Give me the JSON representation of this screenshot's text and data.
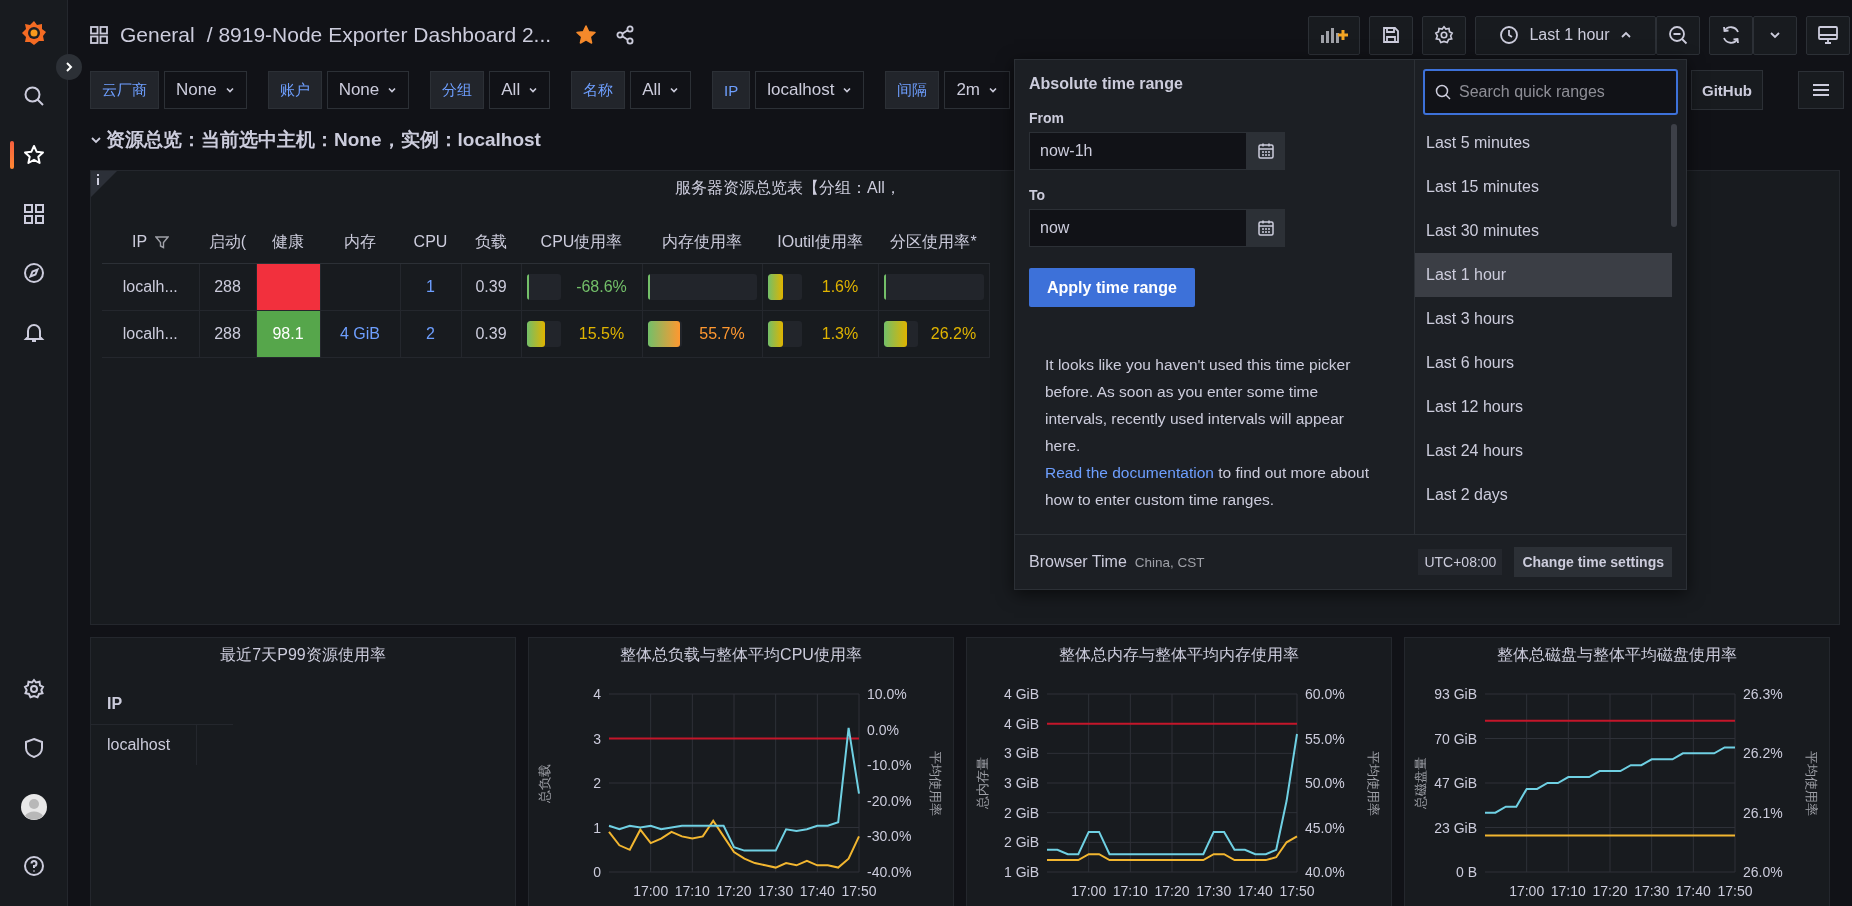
{
  "sidebar": {
    "items": [
      {
        "kind": "search",
        "selected": false
      },
      {
        "kind": "star",
        "selected": true
      },
      {
        "kind": "dashboards",
        "selected": false
      },
      {
        "kind": "explore",
        "selected": false
      },
      {
        "kind": "alerts",
        "selected": false
      }
    ],
    "bottom_items": [
      {
        "kind": "settings"
      },
      {
        "kind": "shield"
      },
      {
        "kind": "avatar"
      },
      {
        "kind": "help"
      }
    ]
  },
  "header": {
    "folder": "General",
    "title": "/ 8919-Node Exporter Dashboard 2...",
    "starred": true,
    "time_range": "Last 1 hour",
    "picker_open": true
  },
  "variables": [
    {
      "label": "云厂商",
      "value": "None"
    },
    {
      "label": "账户",
      "value": "None"
    },
    {
      "label": "分组",
      "value": "All"
    },
    {
      "label": "名称",
      "value": "All"
    },
    {
      "label": "IP",
      "value": "localhost"
    },
    {
      "label": "间隔",
      "value": "2m"
    }
  ],
  "links": [
    {
      "label": "GitHub"
    }
  ],
  "row": {
    "title": "资源总览：当前选中主机：None，实例：localhost",
    "expanded": true
  },
  "table_panel": {
    "title": "服务器资源总览表【分组：All，",
    "columns": [
      {
        "label": "IP",
        "filter": true
      },
      {
        "label": "启动(",
        "filter": false
      },
      {
        "label": "健康",
        "filter": false
      },
      {
        "label": "内存",
        "filter": false
      },
      {
        "label": "CPU",
        "filter": false
      },
      {
        "label": "负载",
        "filter": false
      },
      {
        "label": "CPU使用率",
        "filter": false
      },
      {
        "label": "内存使用率",
        "filter": false
      },
      {
        "label": "IOutil使用率",
        "filter": false
      },
      {
        "label": "分区使用率*",
        "filter": false
      }
    ],
    "rows": [
      {
        "ip": "localh...",
        "uptime": "288",
        "health": {
          "color": "#f2303d"
        },
        "cpu": "1",
        "load": "0.39",
        "gauges": [
          {
            "level": 0,
            "value": "-68.6%",
            "color": "#73bf69"
          },
          {
            "level": 0
          },
          {
            "level": 0.45,
            "value": "1.6%",
            "color": "#e0b400"
          },
          {
            "level": 0
          }
        ]
      },
      {
        "ip": "localh...",
        "uptime": "288",
        "health": {
          "value": "98.1",
          "color": "#56a64b"
        },
        "memory": "4 GiB",
        "cpu": "2",
        "load": "0.39",
        "gauges": [
          {
            "level": 0.55,
            "value": "15.5%",
            "color": "#e0b400"
          },
          {
            "level": 0.95,
            "value": "55.7%",
            "color": "#ff9830"
          },
          {
            "level": 0.45,
            "value": "1.3%",
            "color": "#e0b400"
          },
          {
            "level": 0.7,
            "value": "26.2%",
            "color": "#e0b400"
          }
        ]
      }
    ]
  },
  "bottom_panels": [
    {
      "kind": "table",
      "title": "最近7天P99资源使用率",
      "columns": [
        "IP"
      ],
      "rows": [
        [
          "localhost"
        ]
      ]
    },
    {
      "kind": "chart",
      "title": "整体总负载与整体平均CPU使用率",
      "chart_data": {
        "type": "line",
        "grid": true,
        "ylabel": "总负载",
        "y2label": "平均使用率",
        "ylim": [
          0,
          4
        ],
        "yticks": [
          0,
          1,
          2,
          3,
          4
        ],
        "y2lim": [
          -40,
          10
        ],
        "y2ticks": [
          {
            "value": 10,
            "label": "10.0%"
          },
          {
            "value": 0,
            "label": "0.0%"
          },
          {
            "value": -10,
            "label": "-10.0%"
          },
          {
            "value": -20,
            "label": "-20.0%"
          },
          {
            "value": -30,
            "label": "-30.0%"
          },
          {
            "value": -40,
            "label": "-40.0%"
          }
        ],
        "categories": [
          null,
          null,
          null,
          null,
          "17:00",
          null,
          null,
          null,
          "17:10",
          null,
          null,
          null,
          "17:20",
          null,
          null,
          null,
          "17:30",
          null,
          null,
          null,
          "17:40",
          null,
          null,
          null,
          "17:50"
        ],
        "series": [
          {
            "color": "#c4162a",
            "values": [
              3,
              3,
              3,
              3,
              3,
              3,
              3,
              3,
              3,
              3,
              3,
              3,
              3,
              3,
              3,
              3,
              3,
              3,
              3,
              3,
              3,
              3,
              3,
              3,
              3
            ]
          },
          {
            "color": "#f2b630",
            "values": [
              0.9,
              0.6,
              0.5,
              0.95,
              0.65,
              0.75,
              0.9,
              0.8,
              0.75,
              0.8,
              1.15,
              0.8,
              0.45,
              0.3,
              0.2,
              0.15,
              0.1,
              0.2,
              0.15,
              0.25,
              0.15,
              0.15,
              0.1,
              0.3,
              0.8
            ]
          },
          {
            "color": "#6fd0e3",
            "axis": "y2",
            "values": [
              -27,
              -28,
              -27,
              -27.5,
              -27,
              -28,
              -27.5,
              -27,
              -27,
              -27,
              -27,
              -27,
              -33,
              -34,
              -34,
              -34,
              -34,
              -28,
              -28.5,
              -28,
              -27,
              -27,
              -26,
              0.5,
              -18
            ]
          }
        ]
      }
    },
    {
      "kind": "chart",
      "title": "整体总内存与整体平均内存使用率",
      "chart_data": {
        "type": "line",
        "grid": true,
        "ylabel": "总内存量",
        "y2label": "平均使用率",
        "ylim": [
          1,
          4
        ],
        "yticks": [
          {
            "value": 1,
            "label": "1 GiB"
          },
          {
            "value": 1.5,
            "label": "2 GiB"
          },
          {
            "value": 2,
            "label": "2 GiB"
          },
          {
            "value": 2.5,
            "label": "3 GiB"
          },
          {
            "value": 3,
            "label": "3 GiB"
          },
          {
            "value": 3.5,
            "label": "4 GiB"
          },
          {
            "value": 4,
            "label": "4 GiB"
          }
        ],
        "y2lim": [
          40,
          60
        ],
        "y2ticks": [
          {
            "value": 60,
            "label": "60.0%"
          },
          {
            "value": 55,
            "label": "55.0%"
          },
          {
            "value": 50,
            "label": "50.0%"
          },
          {
            "value": 45,
            "label": "45.0%"
          },
          {
            "value": 40,
            "label": "40.0%"
          }
        ],
        "categories": [
          null,
          null,
          null,
          null,
          "17:00",
          null,
          null,
          null,
          "17:10",
          null,
          null,
          null,
          "17:20",
          null,
          null,
          null,
          "17:30",
          null,
          null,
          null,
          "17:40",
          null,
          null,
          null,
          "17:50"
        ],
        "series": [
          {
            "color": "#c4162a",
            "values": [
              3.5,
              3.5,
              3.5,
              3.5,
              3.5,
              3.5,
              3.5,
              3.5,
              3.5,
              3.5,
              3.5,
              3.5,
              3.5,
              3.5,
              3.5,
              3.5,
              3.5,
              3.5,
              3.5,
              3.5,
              3.5,
              3.5,
              3.5,
              3.5,
              3.5
            ]
          },
          {
            "color": "#f2b630",
            "values": [
              1.2,
              1.2,
              1.2,
              1.2,
              1.3,
              1.3,
              1.2,
              1.2,
              1.2,
              1.2,
              1.2,
              1.2,
              1.2,
              1.2,
              1.2,
              1.2,
              1.3,
              1.3,
              1.2,
              1.2,
              1.2,
              1.2,
              1.25,
              1.5,
              1.6
            ]
          },
          {
            "color": "#6fd0e3",
            "axis": "y2",
            "values": [
              42.5,
              42.5,
              42,
              42,
              44.5,
              44.5,
              42,
              42,
              42,
              42,
              42,
              42,
              42,
              42,
              42,
              42,
              44.5,
              44.5,
              42.5,
              42.5,
              42,
              42,
              42.5,
              48,
              55.5
            ]
          }
        ]
      }
    },
    {
      "kind": "chart",
      "title": "整体总磁盘与整体平均磁盘使用率",
      "chart_data": {
        "type": "line",
        "grid": true,
        "ylabel": "总磁盘量",
        "y2label": "平均使用率",
        "ylim": [
          0,
          93
        ],
        "yticks": [
          {
            "value": 0,
            "label": "0 B"
          },
          {
            "value": 23.25,
            "label": "23 GiB"
          },
          {
            "value": 46.5,
            "label": "47 GiB"
          },
          {
            "value": 69.75,
            "label": "70 GiB"
          },
          {
            "value": 93,
            "label": "93 GiB"
          }
        ],
        "y2lim": [
          26.0,
          26.3
        ],
        "y2ticks": [
          {
            "value": 26.3,
            "label": "26.3%"
          },
          {
            "value": 26.2,
            "label": "26.2%"
          },
          {
            "value": 26.1,
            "label": "26.1%"
          },
          {
            "value": 26.0,
            "label": "26.0%"
          }
        ],
        "categories": [
          null,
          null,
          null,
          null,
          "17:00",
          null,
          null,
          null,
          "17:10",
          null,
          null,
          null,
          "17:20",
          null,
          null,
          null,
          "17:30",
          null,
          null,
          null,
          "17:40",
          null,
          null,
          null,
          "17:50"
        ],
        "series": [
          {
            "color": "#c4162a",
            "values": [
              79,
              79,
              79,
              79,
              79,
              79,
              79,
              79,
              79,
              79,
              79,
              79,
              79,
              79,
              79,
              79,
              79,
              79,
              79,
              79,
              79,
              79,
              79,
              79,
              79
            ]
          },
          {
            "color": "#f2b630",
            "values": [
              19,
              19,
              19,
              19,
              19,
              19,
              19,
              19,
              19,
              19,
              19,
              19,
              19,
              19,
              19,
              19,
              19,
              19,
              19,
              19,
              19,
              19,
              19,
              19,
              19
            ]
          },
          {
            "color": "#6fd0e3",
            "axis": "y2",
            "values": [
              26.1,
              26.1,
              26.11,
              26.11,
              26.14,
              26.14,
              26.15,
              26.15,
              26.16,
              26.16,
              26.16,
              26.17,
              26.17,
              26.17,
              26.18,
              26.18,
              26.19,
              26.19,
              26.19,
              26.2,
              26.2,
              26.2,
              26.2,
              26.21,
              26.21
            ]
          }
        ]
      }
    }
  ],
  "time_picker": {
    "title": "Absolute time range",
    "from_label": "From",
    "from": "now-1h",
    "to_label": "To",
    "to": "now",
    "apply": "Apply time range",
    "help": "It looks like you haven't used this time picker before. As soon as you enter some time intervals, recently used intervals will appear here.",
    "doc_link": "Read the documentation",
    "doc_rest": "to find out more about how to enter custom time ranges.",
    "search_placeholder": "Search quick ranges",
    "quick_ranges": [
      {
        "label": "Last 5 minutes",
        "selected": false
      },
      {
        "label": "Last 15 minutes",
        "selected": false
      },
      {
        "label": "Last 30 minutes",
        "selected": false
      },
      {
        "label": "Last 1 hour",
        "selected": true
      },
      {
        "label": "Last 3 hours",
        "selected": false
      },
      {
        "label": "Last 6 hours",
        "selected": false
      },
      {
        "label": "Last 12 hours",
        "selected": false
      },
      {
        "label": "Last 24 hours",
        "selected": false
      },
      {
        "label": "Last 2 days",
        "selected": false
      }
    ],
    "footer_label": "Browser Time",
    "footer_zone": "China, CST",
    "utc": "UTC+08:00",
    "change": "Change time settings"
  }
}
